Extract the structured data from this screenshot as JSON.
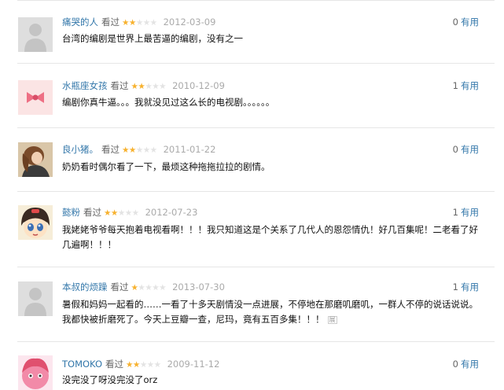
{
  "comments": [
    {
      "user": "痛哭的人",
      "watched": "看过",
      "rating": 2,
      "date": "2012-03-09",
      "useful_count": "0",
      "useful_label": "有用",
      "text": "台湾的编剧是世界上最苦逼的编剧，没有之一",
      "avatar": "default-avatar"
    },
    {
      "user": "水瓶座女孩",
      "watched": "看过",
      "rating": 2,
      "date": "2010-12-09",
      "useful_count": "1",
      "useful_label": "有用",
      "text": "编剧你真牛逼。。。我就没见过这么长的电视剧。。。。。。",
      "avatar": "pink-bow-avatar"
    },
    {
      "user": "良小猪。",
      "watched": "看过",
      "rating": 2,
      "date": "2011-01-22",
      "useful_count": "0",
      "useful_label": "有用",
      "text": "奶奶看时偶尔看了一下，最烦这种拖拖拉拉的剧情。",
      "avatar": "photo-avatar"
    },
    {
      "user": "懿粉",
      "watched": "看过",
      "rating": 2,
      "date": "2012-07-23",
      "useful_count": "1",
      "useful_label": "有用",
      "text": "我姥姥爷爷每天抱着电视看啊！！！我只知道这是个关系了几代人的恩怨情仇！好几百集呢！二老看了好几遍啊！！！",
      "avatar": "cartoon-girl-avatar"
    },
    {
      "user": "本叔的烦躁",
      "watched": "看过",
      "rating": 1,
      "date": "2013-07-30",
      "useful_count": "1",
      "useful_label": "有用",
      "text": "暑假和妈妈一起看的……一看了十多天剧情没一点进展，不停地在那磨叽磨叽，一群人不停的说话说说。我都快被折磨死了。今天上豆瓣一查，尼玛，竟有五百多集！！！",
      "more": "展",
      "avatar": "default-avatar"
    },
    {
      "user": "TOMOKO",
      "watched": "看过",
      "rating": 2,
      "date": "2009-11-12",
      "useful_count": "0",
      "useful_label": "有用",
      "text": "没完没了呀没完没了orz",
      "avatar": "pink-cartoon-avatar"
    }
  ],
  "colors": {
    "username": "#3377aa",
    "star_on": "#f7b12d",
    "star_off": "#e3e3e3",
    "date": "#aaaaaa"
  }
}
